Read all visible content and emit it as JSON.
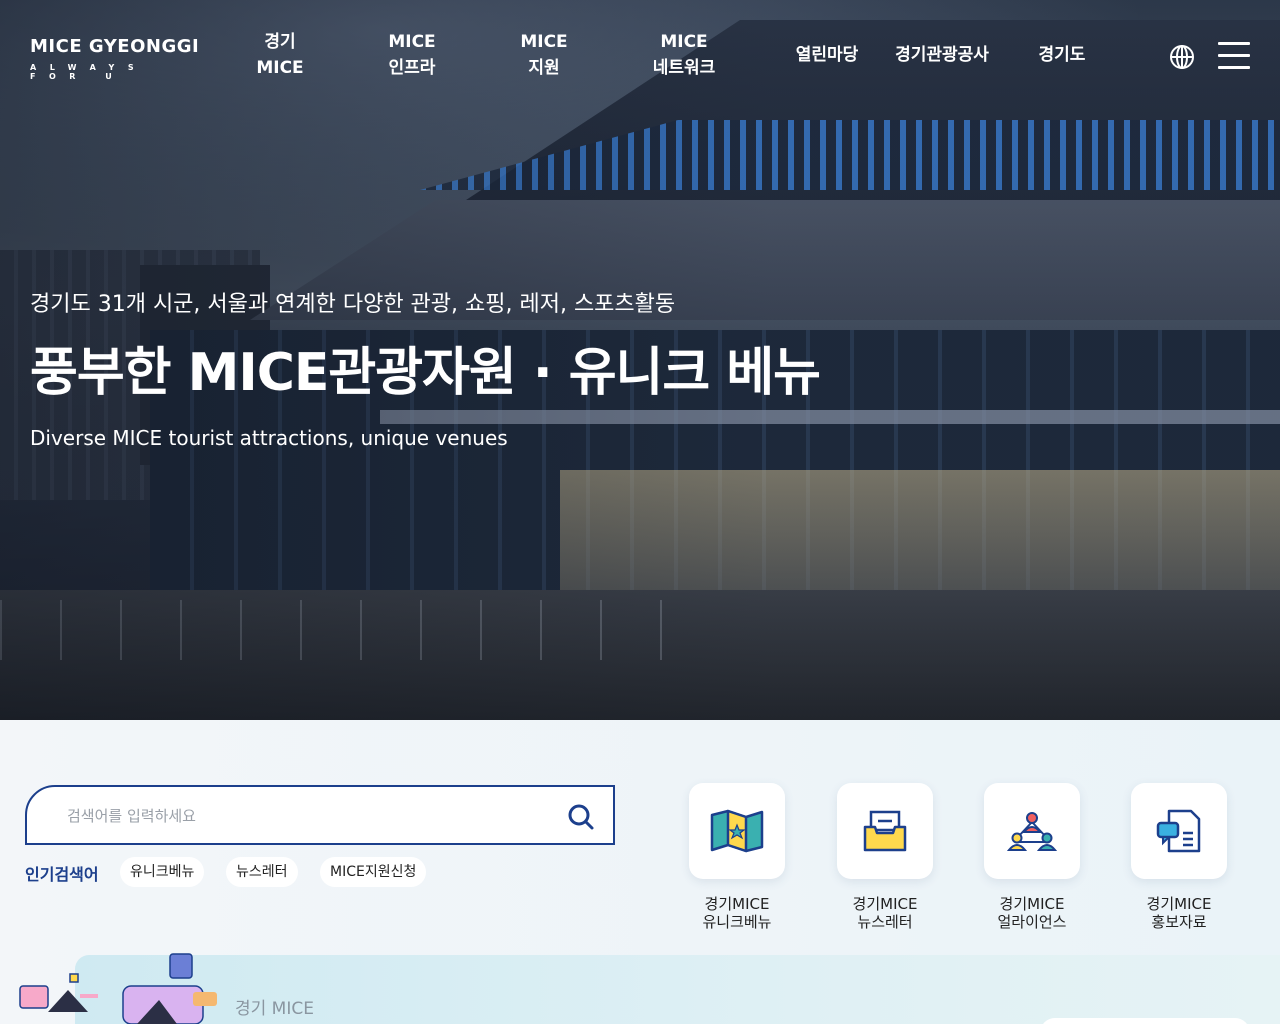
{
  "header": {
    "logo": {
      "main": "MICE GYEONGGI",
      "sub": "ALWAYS FOR U"
    },
    "nav": [
      {
        "line1": "경기",
        "line2": "MICE"
      },
      {
        "line1": "MICE",
        "line2": "인프라"
      },
      {
        "line1": "MICE",
        "line2": "지원"
      },
      {
        "line1": "MICE",
        "line2": "네트워크"
      },
      {
        "line1": "열린마당",
        "line2": ""
      },
      {
        "line1": "경기관광공사",
        "line2": ""
      },
      {
        "line1": "경기도",
        "line2": ""
      }
    ],
    "icons": {
      "language": "globe-icon",
      "menu": "hamburger-menu-icon"
    }
  },
  "hero": {
    "subtitle": "경기도 31개 시군, 서울과 연계한 다양한 관광, 쇼핑, 레저, 스포츠활동",
    "title": "풍부한 MICE관광자원 · 유니크 베뉴",
    "english": "Diverse MICE tourist attractions, unique venues"
  },
  "search": {
    "placeholder": "검색어를 입력하세요",
    "value": "",
    "popular_label": "인기검색어",
    "popular": [
      "유니크베뉴",
      "뉴스레터",
      "MICE지원신청"
    ]
  },
  "quick_links": [
    {
      "line1": "경기MICE",
      "line2": "유니크베뉴",
      "icon": "map-icon"
    },
    {
      "line1": "경기MICE",
      "line2": "뉴스레터",
      "icon": "inbox-tray-icon"
    },
    {
      "line1": "경기MICE",
      "line2": "얼라이언스",
      "icon": "network-people-icon"
    },
    {
      "line1": "경기MICE",
      "line2": "홍보자료",
      "icon": "document-chat-icon"
    }
  ],
  "banner": {
    "label": "경기 MICE"
  },
  "colors": {
    "primary": "#1c3f8c",
    "accent": "#2a6fc9",
    "bg": "#eef4f8"
  }
}
